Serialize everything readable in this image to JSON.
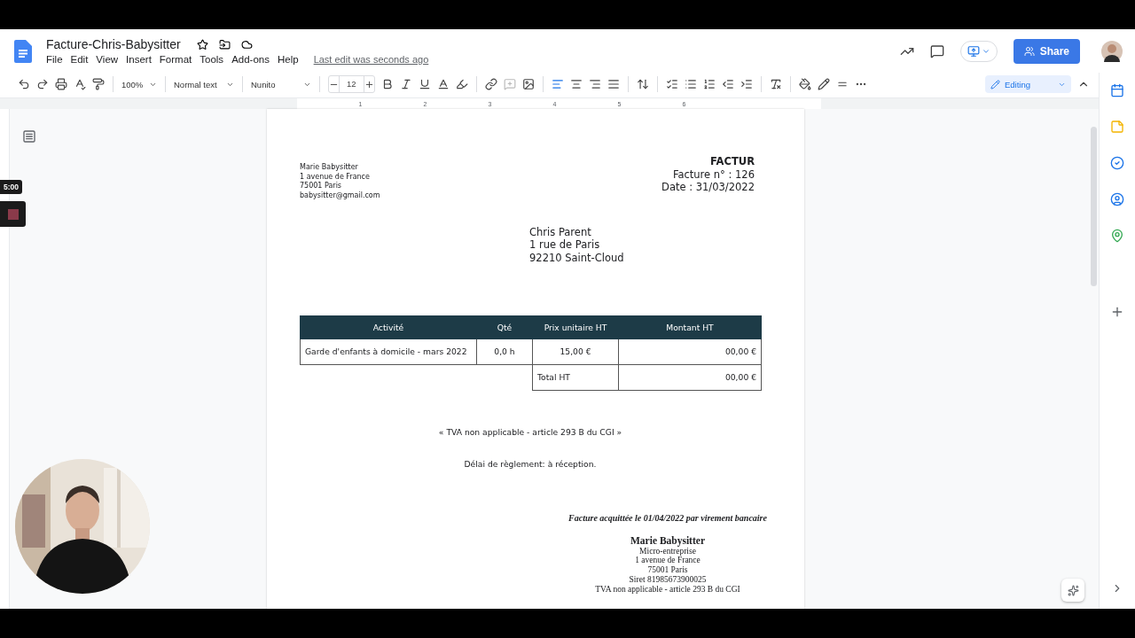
{
  "document": {
    "title": "Facture-Chris-Babysitter",
    "last_edit": "Last edit was seconds ago"
  },
  "menu": [
    "File",
    "Edit",
    "View",
    "Insert",
    "Format",
    "Tools",
    "Add-ons",
    "Help"
  ],
  "toolbar": {
    "zoom": "100%",
    "style": "Normal text",
    "font": "Nunito",
    "font_size": "12",
    "mode": "Editing"
  },
  "share_button": "Share",
  "ruler_numbers": [
    "1",
    "2",
    "3",
    "4",
    "5",
    "6"
  ],
  "recorder": {
    "time": "5:00"
  },
  "page": {
    "title": "FACTUR",
    "invoice_number": "Facture n° : 126",
    "date": "Date : 31/03/2022",
    "sender": [
      "Marie Babysitter",
      "1 avenue de France",
      "75001 Paris",
      "babysitter@gmail.com"
    ],
    "recipient": [
      "Chris Parent",
      "1 rue de Paris",
      "92210 Saint-Cloud"
    ],
    "table": {
      "columns": [
        "Activité",
        "Qté",
        "Prix unitaire HT",
        "Montant HT"
      ],
      "rows": [
        [
          "Garde d'enfants à domicile - mars 2022",
          "0,0 h",
          "15,00 €",
          "00,00 €"
        ]
      ],
      "total": {
        "label": "Total HT",
        "value": "00,00 €"
      }
    },
    "vat_note": "« TVA non applicable - article 293 B du CGI »",
    "payment_terms": "Délai de règlement: à réception.",
    "paid_note": "Facture acquittée le 01/04/2022 par virement bancaire",
    "signature": {
      "name": "Marie Babysitter",
      "lines": [
        "Micro-entreprise",
        "1 avenue de France",
        "75001 Paris",
        "Siret 81985673900025",
        "TVA non applicable - article 293 B du CGI"
      ]
    }
  }
}
